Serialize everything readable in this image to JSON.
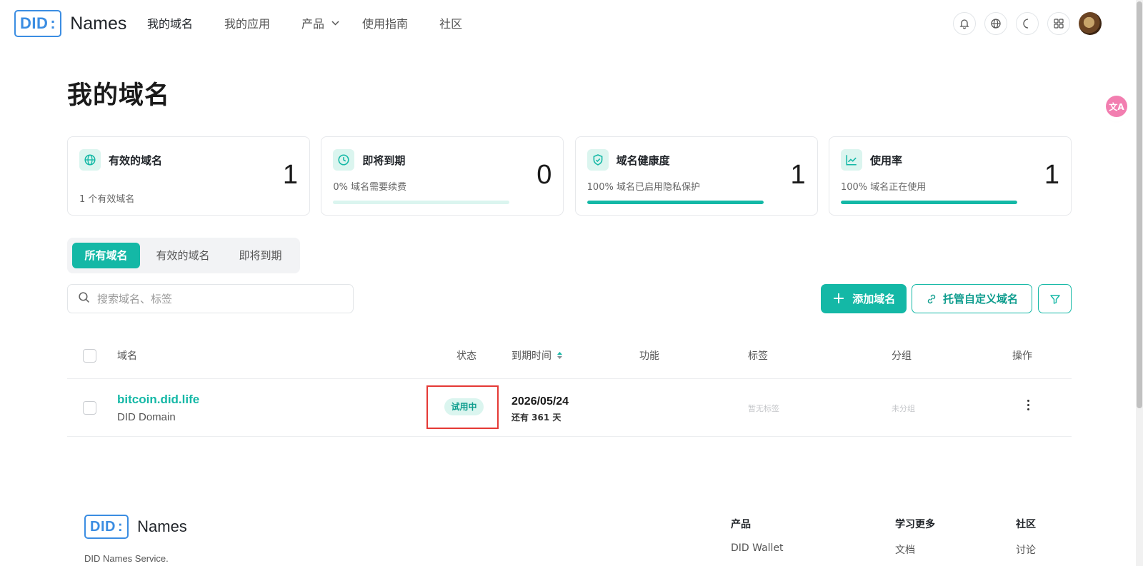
{
  "brand": {
    "logo_mark": "DID",
    "logo_colon": ":",
    "name": "Names"
  },
  "nav": {
    "items": [
      {
        "label": "我的域名",
        "active": true
      },
      {
        "label": "我的应用"
      },
      {
        "label": "产品",
        "has_dropdown": true
      },
      {
        "label": "使用指南"
      },
      {
        "label": "社区"
      }
    ]
  },
  "header_icons": [
    "bell-icon",
    "globe-icon",
    "moon-icon",
    "apps-grid-icon"
  ],
  "translate_widget": {
    "icon": "translate-icon",
    "label": "文A"
  },
  "page": {
    "title": "我的域名"
  },
  "stats": [
    {
      "icon": "globe-icon",
      "title": "有效的域名",
      "subtitle": "1 个有效域名",
      "value": "1"
    },
    {
      "icon": "clock-icon",
      "title": "即将到期",
      "subtitle": "0% 域名需要续费",
      "value": "0",
      "progress": 0
    },
    {
      "icon": "shield-check-icon",
      "title": "域名健康度",
      "subtitle": "100% 域名已启用隐私保护",
      "value": "1",
      "progress": 1
    },
    {
      "icon": "chart-line-icon",
      "title": "使用率",
      "subtitle": "100% 域名正在使用",
      "value": "1",
      "progress": 1
    }
  ],
  "tabs": [
    {
      "label": "所有域名",
      "active": true
    },
    {
      "label": "有效的域名"
    },
    {
      "label": "即将到期"
    }
  ],
  "search": {
    "placeholder": "搜索域名、标签",
    "value": ""
  },
  "actions": {
    "add_plus": "+",
    "add_label": "添加域名",
    "host_label": "托管自定义域名"
  },
  "table": {
    "headers": {
      "domain": "域名",
      "status": "状态",
      "expiry": "到期时间",
      "features": "功能",
      "tags": "标签",
      "group": "分组",
      "actions": "操作"
    },
    "rows": [
      {
        "domain": "bitcoin.did.life",
        "type": "DID Domain",
        "status": "试用中",
        "expiry_date": "2026/05/24",
        "expiry_left": "还有 361 天",
        "tags": "暂无标签",
        "group": "未分组"
      }
    ]
  },
  "footer": {
    "description": "DID Names Service.",
    "columns": [
      {
        "title": "产品",
        "first_link": "DID Wallet"
      },
      {
        "title": "学习更多",
        "first_link": "文档"
      },
      {
        "title": "社区",
        "first_link": "讨论"
      }
    ]
  },
  "colors": {
    "accent": "#14b8a6",
    "accent_light": "#dbf5ef",
    "logo_blue": "#3b8de2",
    "highlight_red": "#e53935"
  }
}
